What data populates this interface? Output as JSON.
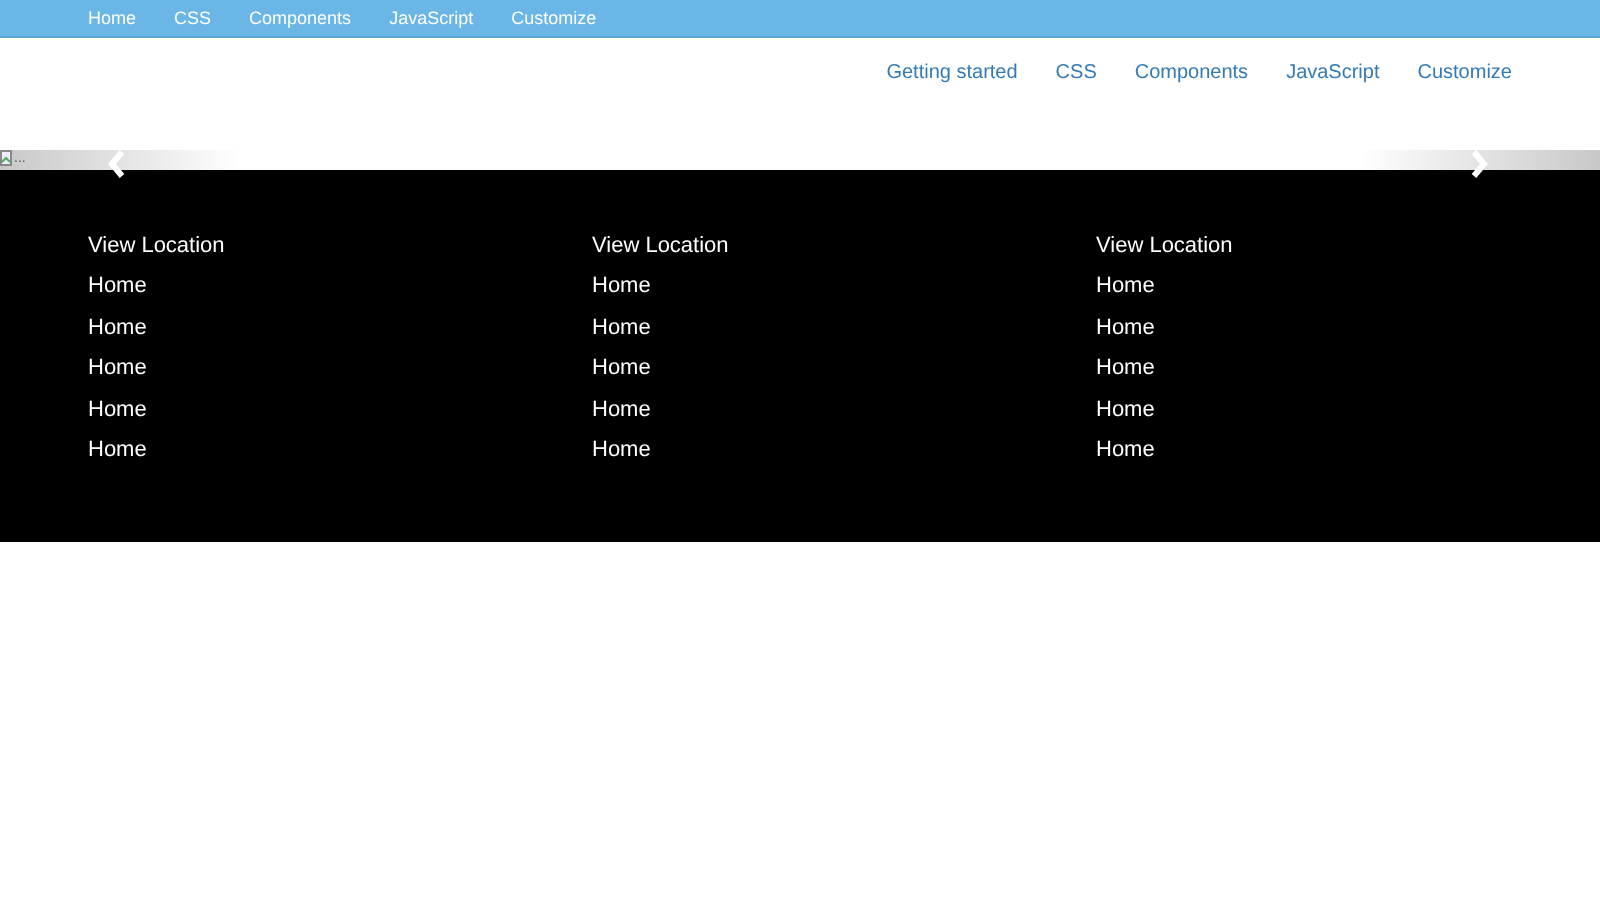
{
  "top_nav": {
    "items": [
      "Home",
      "CSS",
      "Components",
      "JavaScript",
      "Customize"
    ]
  },
  "main_nav": {
    "items": [
      "Getting started",
      "CSS",
      "Components",
      "JavaScript",
      "Customize"
    ]
  },
  "carousel": {
    "image_alt": "..."
  },
  "footer": {
    "columns": [
      {
        "title": "View Location",
        "links": [
          "Home",
          "Home",
          "Home",
          "Home",
          "Home"
        ]
      },
      {
        "title": "View Location",
        "links": [
          "Home",
          "Home",
          "Home",
          "Home",
          "Home"
        ]
      },
      {
        "title": "View Location",
        "links": [
          "Home",
          "Home",
          "Home",
          "Home",
          "Home"
        ]
      }
    ]
  }
}
